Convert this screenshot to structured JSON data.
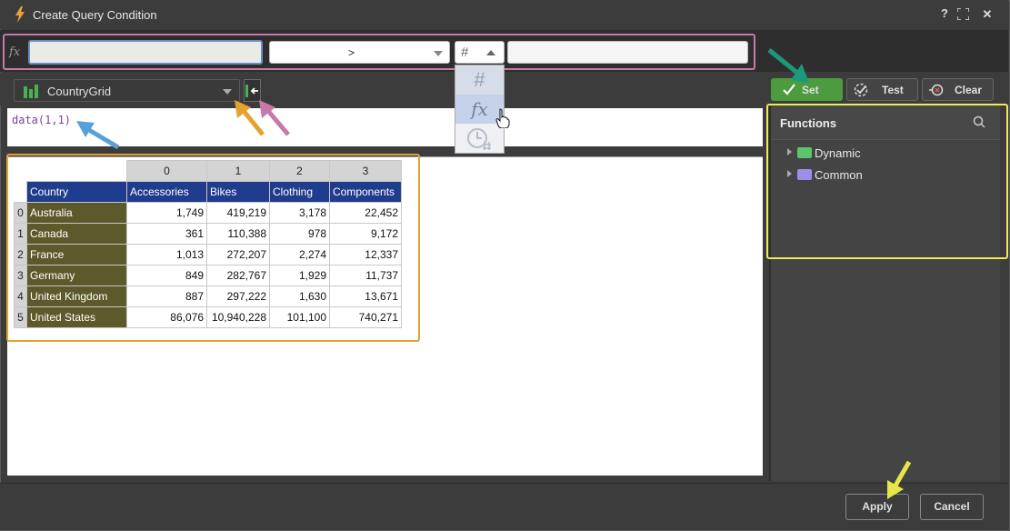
{
  "window": {
    "title": "Create Query Condition",
    "help_label": "?",
    "close_label": "✕"
  },
  "condition": {
    "fx_label": "fx",
    "lhs_value": "",
    "operator": ">",
    "type_symbol": "#",
    "rhs_value": ""
  },
  "type_dropdown": {
    "options": [
      {
        "name": "number",
        "symbol": "#"
      },
      {
        "name": "function",
        "symbol": "fx"
      },
      {
        "name": "datetime",
        "symbol": "time-hash-icon"
      }
    ],
    "highlighted": "function"
  },
  "toolbar": {
    "source": "CountryGrid",
    "set_label": "Set",
    "test_label": "Test",
    "clear_label": "Clear"
  },
  "editor": {
    "expression": "data(1,1)"
  },
  "grid": {
    "col_indices": [
      "0",
      "1",
      "2",
      "3"
    ],
    "headers": [
      "Country",
      "Accessories",
      "Bikes",
      "Clothing",
      "Components"
    ],
    "rows": [
      {
        "idx": "0",
        "country": "Australia",
        "values": [
          "1,749",
          "419,219",
          "3,178",
          "22,452"
        ]
      },
      {
        "idx": "1",
        "country": "Canada",
        "values": [
          "361",
          "110,388",
          "978",
          "9,172"
        ]
      },
      {
        "idx": "2",
        "country": "France",
        "values": [
          "1,013",
          "272,207",
          "2,274",
          "12,337"
        ]
      },
      {
        "idx": "3",
        "country": "Germany",
        "values": [
          "849",
          "282,767",
          "1,929",
          "11,737"
        ]
      },
      {
        "idx": "4",
        "country": "United Kingdom",
        "values": [
          "887",
          "297,222",
          "1,630",
          "13,671"
        ]
      },
      {
        "idx": "5",
        "country": "United States",
        "values": [
          "86,076",
          "10,940,228",
          "101,100",
          "740,271"
        ]
      }
    ]
  },
  "functions": {
    "title": "Functions",
    "items": [
      {
        "label": "Dynamic",
        "color": "#5cc46a"
      },
      {
        "label": "Common",
        "color": "#9b8fe8"
      }
    ]
  },
  "footer": {
    "apply_label": "Apply",
    "cancel_label": "Cancel"
  },
  "colors": {
    "set_button": "#4c9b3e",
    "header_row": "#1f3c8d",
    "country_col": "#5c5a2a",
    "annotation_pink": "#c77aa8",
    "annotation_orange": "#e3a32c",
    "annotation_yellow": "#ecec5a",
    "annotation_blue": "#5aa0d8",
    "annotation_teal": "#1a9a7a"
  }
}
